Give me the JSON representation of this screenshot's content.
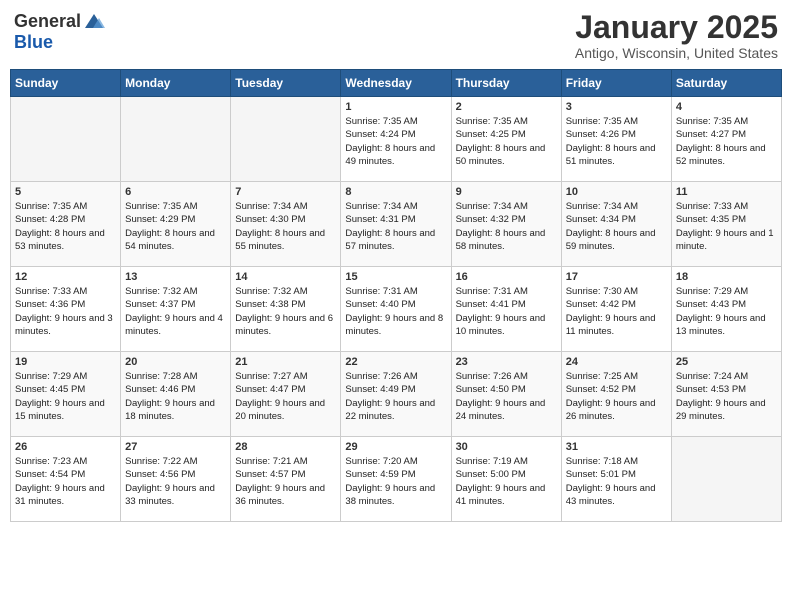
{
  "header": {
    "logo_general": "General",
    "logo_blue": "Blue",
    "month_title": "January 2025",
    "location": "Antigo, Wisconsin, United States"
  },
  "days_of_week": [
    "Sunday",
    "Monday",
    "Tuesday",
    "Wednesday",
    "Thursday",
    "Friday",
    "Saturday"
  ],
  "weeks": [
    [
      {
        "day": "",
        "info": ""
      },
      {
        "day": "",
        "info": ""
      },
      {
        "day": "",
        "info": ""
      },
      {
        "day": "1",
        "info": "Sunrise: 7:35 AM\nSunset: 4:24 PM\nDaylight: 8 hours\nand 49 minutes."
      },
      {
        "day": "2",
        "info": "Sunrise: 7:35 AM\nSunset: 4:25 PM\nDaylight: 8 hours\nand 50 minutes."
      },
      {
        "day": "3",
        "info": "Sunrise: 7:35 AM\nSunset: 4:26 PM\nDaylight: 8 hours\nand 51 minutes."
      },
      {
        "day": "4",
        "info": "Sunrise: 7:35 AM\nSunset: 4:27 PM\nDaylight: 8 hours\nand 52 minutes."
      }
    ],
    [
      {
        "day": "5",
        "info": "Sunrise: 7:35 AM\nSunset: 4:28 PM\nDaylight: 8 hours\nand 53 minutes."
      },
      {
        "day": "6",
        "info": "Sunrise: 7:35 AM\nSunset: 4:29 PM\nDaylight: 8 hours\nand 54 minutes."
      },
      {
        "day": "7",
        "info": "Sunrise: 7:34 AM\nSunset: 4:30 PM\nDaylight: 8 hours\nand 55 minutes."
      },
      {
        "day": "8",
        "info": "Sunrise: 7:34 AM\nSunset: 4:31 PM\nDaylight: 8 hours\nand 57 minutes."
      },
      {
        "day": "9",
        "info": "Sunrise: 7:34 AM\nSunset: 4:32 PM\nDaylight: 8 hours\nand 58 minutes."
      },
      {
        "day": "10",
        "info": "Sunrise: 7:34 AM\nSunset: 4:34 PM\nDaylight: 8 hours\nand 59 minutes."
      },
      {
        "day": "11",
        "info": "Sunrise: 7:33 AM\nSunset: 4:35 PM\nDaylight: 9 hours\nand 1 minute."
      }
    ],
    [
      {
        "day": "12",
        "info": "Sunrise: 7:33 AM\nSunset: 4:36 PM\nDaylight: 9 hours\nand 3 minutes."
      },
      {
        "day": "13",
        "info": "Sunrise: 7:32 AM\nSunset: 4:37 PM\nDaylight: 9 hours\nand 4 minutes."
      },
      {
        "day": "14",
        "info": "Sunrise: 7:32 AM\nSunset: 4:38 PM\nDaylight: 9 hours\nand 6 minutes."
      },
      {
        "day": "15",
        "info": "Sunrise: 7:31 AM\nSunset: 4:40 PM\nDaylight: 9 hours\nand 8 minutes."
      },
      {
        "day": "16",
        "info": "Sunrise: 7:31 AM\nSunset: 4:41 PM\nDaylight: 9 hours\nand 10 minutes."
      },
      {
        "day": "17",
        "info": "Sunrise: 7:30 AM\nSunset: 4:42 PM\nDaylight: 9 hours\nand 11 minutes."
      },
      {
        "day": "18",
        "info": "Sunrise: 7:29 AM\nSunset: 4:43 PM\nDaylight: 9 hours\nand 13 minutes."
      }
    ],
    [
      {
        "day": "19",
        "info": "Sunrise: 7:29 AM\nSunset: 4:45 PM\nDaylight: 9 hours\nand 15 minutes."
      },
      {
        "day": "20",
        "info": "Sunrise: 7:28 AM\nSunset: 4:46 PM\nDaylight: 9 hours\nand 18 minutes."
      },
      {
        "day": "21",
        "info": "Sunrise: 7:27 AM\nSunset: 4:47 PM\nDaylight: 9 hours\nand 20 minutes."
      },
      {
        "day": "22",
        "info": "Sunrise: 7:26 AM\nSunset: 4:49 PM\nDaylight: 9 hours\nand 22 minutes."
      },
      {
        "day": "23",
        "info": "Sunrise: 7:26 AM\nSunset: 4:50 PM\nDaylight: 9 hours\nand 24 minutes."
      },
      {
        "day": "24",
        "info": "Sunrise: 7:25 AM\nSunset: 4:52 PM\nDaylight: 9 hours\nand 26 minutes."
      },
      {
        "day": "25",
        "info": "Sunrise: 7:24 AM\nSunset: 4:53 PM\nDaylight: 9 hours\nand 29 minutes."
      }
    ],
    [
      {
        "day": "26",
        "info": "Sunrise: 7:23 AM\nSunset: 4:54 PM\nDaylight: 9 hours\nand 31 minutes."
      },
      {
        "day": "27",
        "info": "Sunrise: 7:22 AM\nSunset: 4:56 PM\nDaylight: 9 hours\nand 33 minutes."
      },
      {
        "day": "28",
        "info": "Sunrise: 7:21 AM\nSunset: 4:57 PM\nDaylight: 9 hours\nand 36 minutes."
      },
      {
        "day": "29",
        "info": "Sunrise: 7:20 AM\nSunset: 4:59 PM\nDaylight: 9 hours\nand 38 minutes."
      },
      {
        "day": "30",
        "info": "Sunrise: 7:19 AM\nSunset: 5:00 PM\nDaylight: 9 hours\nand 41 minutes."
      },
      {
        "day": "31",
        "info": "Sunrise: 7:18 AM\nSunset: 5:01 PM\nDaylight: 9 hours\nand 43 minutes."
      },
      {
        "day": "",
        "info": ""
      }
    ]
  ]
}
